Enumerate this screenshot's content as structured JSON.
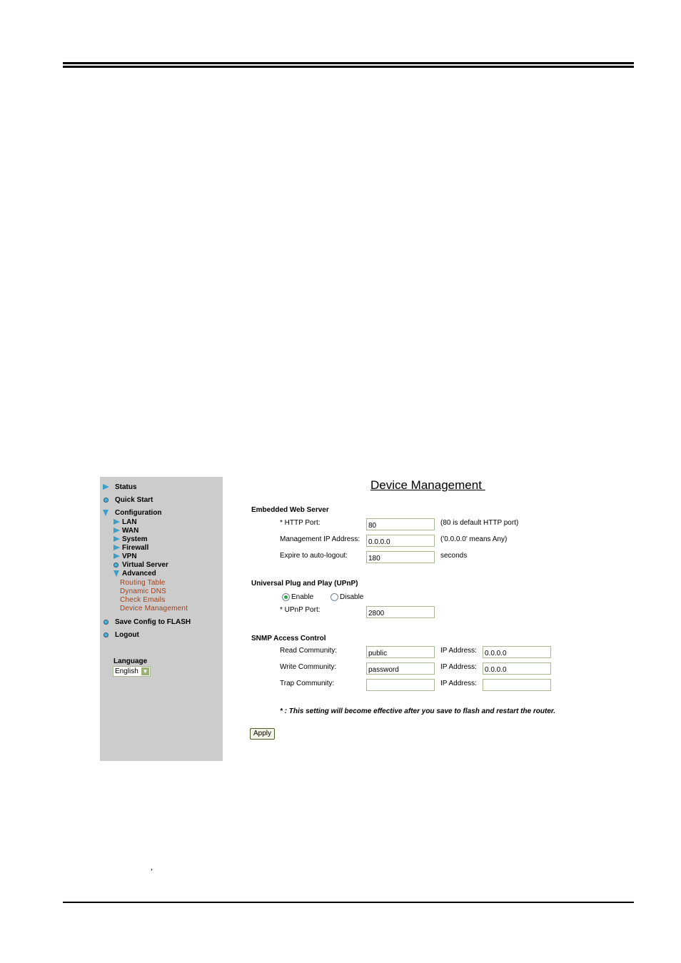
{
  "document": {
    "stray_mark": ","
  },
  "sidebar": {
    "items": [
      {
        "label": "Status",
        "icon": "triangle-right-icon"
      },
      {
        "label": "Quick Start",
        "icon": "bullet-icon"
      },
      {
        "label": "Configuration",
        "icon": "triangle-down-icon"
      }
    ],
    "config_items": [
      {
        "label": "LAN",
        "icon": "triangle-right-icon"
      },
      {
        "label": "WAN",
        "icon": "triangle-right-icon"
      },
      {
        "label": "System",
        "icon": "triangle-right-icon"
      },
      {
        "label": "Firewall",
        "icon": "triangle-right-icon"
      },
      {
        "label": "VPN",
        "icon": "triangle-right-icon"
      },
      {
        "label": "Virtual Server",
        "icon": "bullet-icon"
      },
      {
        "label": "Advanced",
        "icon": "triangle-down-icon"
      }
    ],
    "advanced_items": [
      "Routing Table",
      "Dynamic DNS",
      "Check Emails",
      "Device Management"
    ],
    "bottom_items": [
      {
        "label": "Save Config to FLASH",
        "icon": "bullet-icon"
      },
      {
        "label": "Logout",
        "icon": "bullet-icon"
      }
    ],
    "language": {
      "label": "Language",
      "selected": "English"
    },
    "colors": {
      "background": "#cccccc",
      "icon": "#3aa0c8",
      "sub_link": "#a0401a"
    }
  },
  "main": {
    "title": "Device Management ",
    "web_server": {
      "title": "Embedded Web Server",
      "http_port_label": "* HTTP Port:",
      "http_port_value": "80",
      "http_port_note": "(80 is default HTTP port)",
      "mgmt_ip_label": "Management IP Address:",
      "mgmt_ip_value": "0.0.0.0",
      "mgmt_ip_note": "('0.0.0.0' means Any)",
      "expire_label": "Expire to auto-logout:",
      "expire_value": "180",
      "expire_note": "seconds"
    },
    "upnp": {
      "title": "Universal Plug and Play (UPnP)",
      "enable_label": "Enable",
      "disable_label": "Disable",
      "selected": "Enable",
      "port_label": "* UPnP Port:",
      "port_value": "2800"
    },
    "snmp": {
      "title": "SNMP Access Control",
      "rows": [
        {
          "label": "Read Community:",
          "value": "public",
          "ip_label": "IP Address:",
          "ip_value": "0.0.0.0"
        },
        {
          "label": "Write Community:",
          "value": "password",
          "ip_label": "IP Address:",
          "ip_value": "0.0.0.0"
        },
        {
          "label": "Trap Community:",
          "value": "",
          "ip_label": "IP Address:",
          "ip_value": ""
        }
      ]
    },
    "footnote": "* : This setting will become effective after you save to flash and restart the router.",
    "apply_label": "Apply"
  }
}
